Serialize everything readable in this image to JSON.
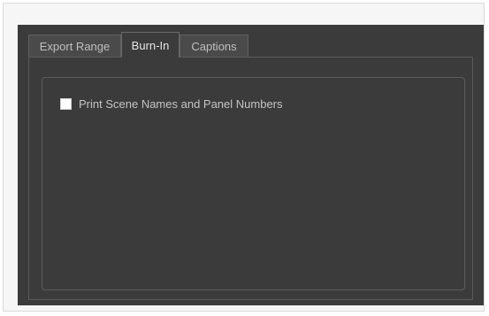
{
  "tabs": [
    {
      "label": "Export Range",
      "active": false
    },
    {
      "label": "Burn-In",
      "active": true
    },
    {
      "label": "Captions",
      "active": false
    }
  ],
  "burn_in": {
    "print_scene_names": {
      "label": "Print Scene Names and Panel Numbers",
      "checked": false
    }
  },
  "colors": {
    "window_bg": "#3b3b3b",
    "tab_bg": "#4a4a4a",
    "text": "#c4c4c4"
  }
}
